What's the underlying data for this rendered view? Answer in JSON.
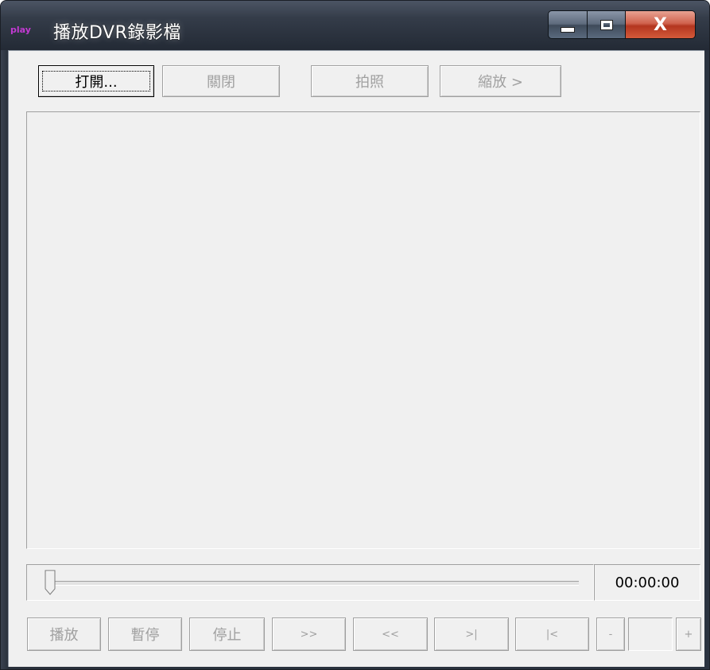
{
  "window": {
    "title": "播放DVR錄影檔",
    "app_icon_text": "play",
    "icon": "app-play-icon"
  },
  "caption_buttons": {
    "minimize_icon": "minimize-icon",
    "maximize_icon": "maximize-icon",
    "close_label": "X"
  },
  "toolbar": {
    "open_label": "打開...",
    "close_label": "關閉",
    "snapshot_label": "拍照",
    "zoom_label": "縮放 >"
  },
  "playback": {
    "position_fraction": 0,
    "time": "00:00:00"
  },
  "controls": {
    "play_label": "播放",
    "pause_label": "暫停",
    "stop_label": "停止",
    "fast_forward_label": ">>",
    "rewind_label": "<<",
    "step_forward_label": ">|",
    "step_back_label": "|<",
    "speed_minus_label": "-",
    "speed_value": "",
    "speed_plus_label": "+"
  },
  "colors": {
    "client_bg": "#f0f0f0",
    "disabled_text": "#a0a0a0",
    "close_button": "#c8442a",
    "app_icon": "#c23ad2"
  }
}
